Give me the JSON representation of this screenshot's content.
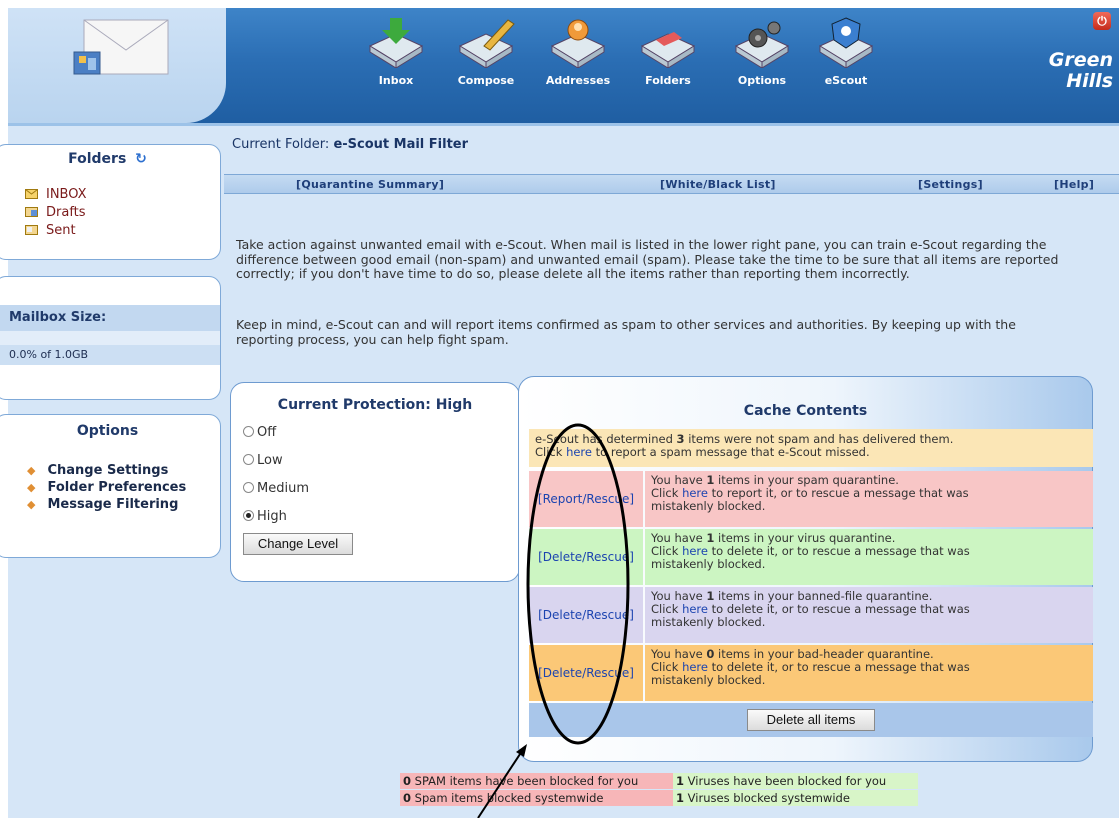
{
  "header": {
    "nav": [
      {
        "label": "Inbox",
        "icon": "inbox-icon"
      },
      {
        "label": "Compose",
        "icon": "compose-icon"
      },
      {
        "label": "Addresses",
        "icon": "addresses-icon"
      },
      {
        "label": "Folders",
        "icon": "folders-icon"
      },
      {
        "label": "Options",
        "icon": "options-gear-icon"
      },
      {
        "label": "eScout",
        "icon": "escout-shield-icon"
      }
    ],
    "brand_line1": "Green",
    "brand_line2": "Hills"
  },
  "sidebar": {
    "folders_title": "Folders",
    "folders": [
      {
        "label": "INBOX",
        "icon": "inbox-folder-icon"
      },
      {
        "label": "Drafts",
        "icon": "drafts-folder-icon"
      },
      {
        "label": "Sent",
        "icon": "sent-folder-icon"
      }
    ],
    "mailbox_title": "Mailbox Size:",
    "mailbox_value": "0.0% of 1.0GB",
    "options_title": "Options",
    "options": [
      "Change Settings",
      "Folder Preferences",
      "Message Filtering"
    ]
  },
  "main": {
    "current_folder_label": "Current Folder:",
    "current_folder_name": "e-Scout Mail Filter",
    "nav_links": [
      "[Quarantine Summary]",
      "[White/Black List]",
      "[Settings]",
      "[Help]"
    ],
    "intro_paragraphs": [
      "Take action against unwanted email with e-Scout. When mail is listed in the lower right pane, you can train e-Scout regarding the difference between good email (non-spam) and unwanted email (spam). Please take the time to be sure that all items are reported correctly; if you don't have time to do so, please delete all the items rather than reporting them incorrectly.",
      "Keep in mind, e-Scout can and will report items confirmed as spam to other services and authorities. By keeping up with the reporting process, you can help fight spam."
    ],
    "protection": {
      "title": "Current Protection: High",
      "levels": [
        "Off",
        "Low",
        "Medium",
        "High"
      ],
      "selected": "High",
      "button": "Change Level"
    },
    "cache": {
      "title": "Cache Contents",
      "delivered_pre": "e-Scout has determined",
      "delivered_count": "3",
      "delivered_post": "items were not spam and has delivered them.",
      "click": "Click",
      "here": "here",
      "delivered_line2_post": "to report a spam message that e-Scout missed.",
      "rows": [
        {
          "action": "[Report/Rescue]",
          "pre": "You have",
          "count": "1",
          "type": "items in your spam quarantine.",
          "verb": "to report it, or to rescue a message that was",
          "tail": "mistakenly blocked.",
          "color": "#f8c6c6"
        },
        {
          "action": "[Delete/Rescue]",
          "pre": "You have",
          "count": "1",
          "type": "items in your virus quarantine.",
          "verb": "to delete it, or to rescue a message that was",
          "tail": "mistakenly blocked.",
          "color": "#ccf5c2"
        },
        {
          "action": "[Delete/Rescue]",
          "pre": "You have",
          "count": "1",
          "type": "items in your banned-file quarantine.",
          "verb": "to delete it, or to rescue a message that was",
          "tail": "mistakenly blocked.",
          "color": "#d9d5ef"
        },
        {
          "action": "[Delete/Rescue]",
          "pre": "You have",
          "count": "0",
          "type": "items in your bad-header quarantine.",
          "verb": "to delete it, or to rescue a message that was",
          "tail": "mistakenly blocked.",
          "color": "#fbc877"
        }
      ],
      "delete_all": "Delete all items"
    },
    "stats": {
      "spam_count": "0",
      "spam_text": "SPAM items have been blocked for you",
      "virus_count": "1",
      "virus_text": "Viruses have been blocked for you",
      "spam_sys_count": "0",
      "spam_sys_text": "Spam items blocked systemwide",
      "virus_sys_count": "1",
      "virus_sys_text": "Viruses blocked systemwide"
    }
  },
  "colors": {
    "header_blue": "#2b6eb4",
    "page_bg": "#d6e6f7",
    "spam": "#f8c6c6",
    "virus": "#ccf5c2",
    "banned": "#d9d5ef",
    "badheader": "#fbc877",
    "delivered": "#fbe6b6"
  }
}
